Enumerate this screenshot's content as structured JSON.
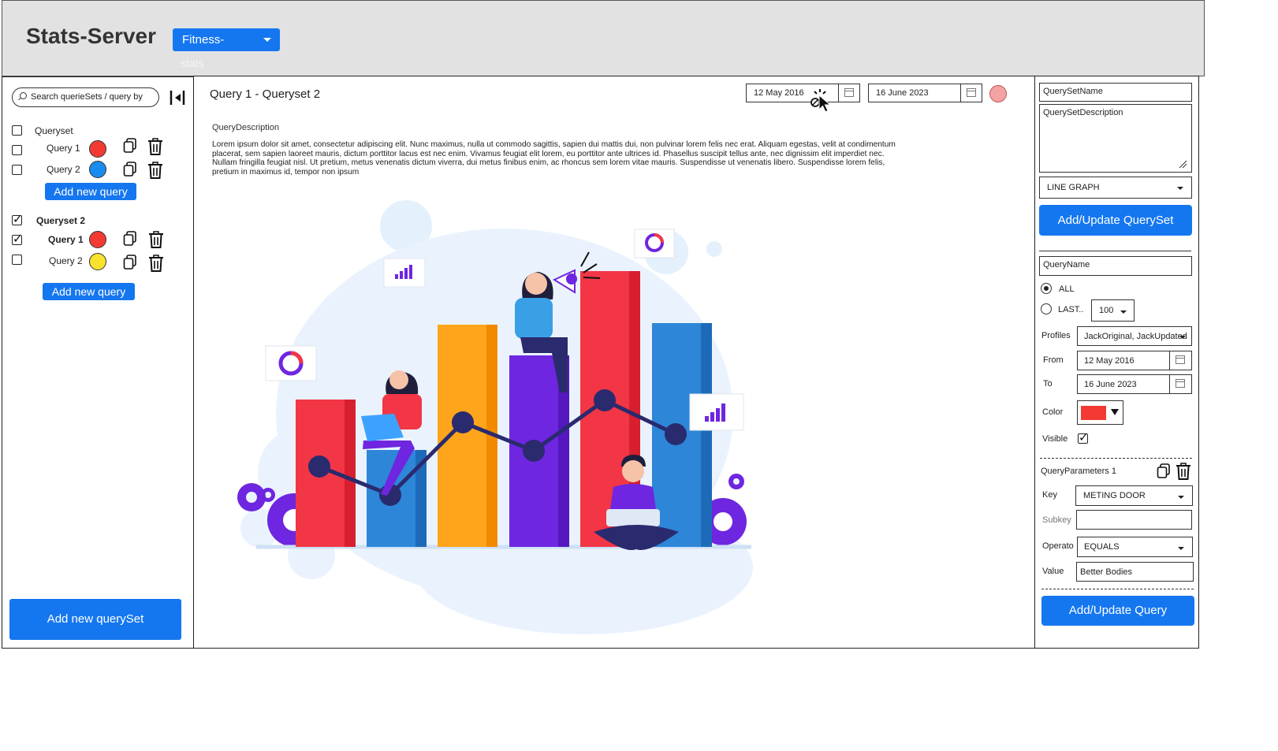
{
  "header": {
    "title": "Stats-Server",
    "dataset_select": {
      "value": "Fitness-",
      "overflow": "stats"
    }
  },
  "sidebar": {
    "search_placeholder": "Search querieSets / query by",
    "querysets": [
      {
        "name": "Queryset",
        "checked": false,
        "bold": false,
        "queries": [
          {
            "name": "Query 1",
            "checked": false,
            "color": "#f23a33"
          },
          {
            "name": "Query 2",
            "checked": false,
            "color": "#1a8cf0"
          }
        ],
        "add_query_label": "Add new query"
      },
      {
        "name": "Queryset 2",
        "checked": true,
        "bold": true,
        "queries": [
          {
            "name": "Query 1",
            "checked": true,
            "color": "#f23a33"
          },
          {
            "name": "Query 2",
            "checked": false,
            "color": "#f8e22e"
          }
        ],
        "add_query_label": "Add new query"
      }
    ],
    "add_queryset_label": "Add new querySet"
  },
  "main": {
    "title": "Query 1 - Queryset 2",
    "date_from": "12 May 2016",
    "date_to": "16 June 2023",
    "status_color": "#f4a3a3",
    "description_label": "QueryDescription",
    "description_text": "Lorem ipsum dolor sit amet, consectetur adipiscing elit. Nunc maximus, nulla ut commodo sagittis, sapien dui mattis dui, non pulvinar lorem felis nec erat. Aliquam egestas, velit at condimentum placerat, sem sapien laoreet mauris, dictum porttitor lacus est nec enim. Vivamus feugiat elit lorem, eu porttitor ante ultrices id. Phasellus suscipit tellus ante, nec dignissim elit imperdiet nec. Nullam fringilla feugiat nisl. Ut pretium, metus venenatis dictum viverra, dui metus finibus enim, ac rhoncus sem lorem vitae mauris. Suspendisse ut venenatis libero. Suspendisse lorem felis, pretium in maximus id, tempor non ipsum"
  },
  "queryset_form": {
    "name_placeholder": "QuerySetName",
    "description_placeholder": "QuerySetDescription",
    "graph_type": "LINE GRAPH",
    "submit_label": "Add/Update QuerySet"
  },
  "query_form": {
    "name_placeholder": "QueryName",
    "radio_all": "ALL",
    "radio_last": "LAST..",
    "last_count": "100",
    "profiles_label": "Profiles",
    "profiles_value": "JackOriginal, JackUpdated",
    "from_label": "From",
    "from_value": "12 May 2016",
    "to_label": "To",
    "to_value": "16 June 2023",
    "color_label": "Color",
    "color_value": "#f23a33",
    "visible_label": "Visible",
    "params_title": "QueryParameters 1",
    "key_label": "Key",
    "key_value": "METING DOOR",
    "subkey_label": "Subkey",
    "subkey_value": "",
    "operator_label": "Operato",
    "operator_value": "EQUALS",
    "value_label": "Value",
    "value_value": "Better Bodies",
    "submit_label": "Add/Update Query"
  },
  "icons": [
    "search-icon",
    "collapse-sidebar-icon",
    "copy-icon",
    "trash-icon",
    "calendar-icon",
    "chevron-down-icon",
    "pointer-cursor-icon"
  ]
}
